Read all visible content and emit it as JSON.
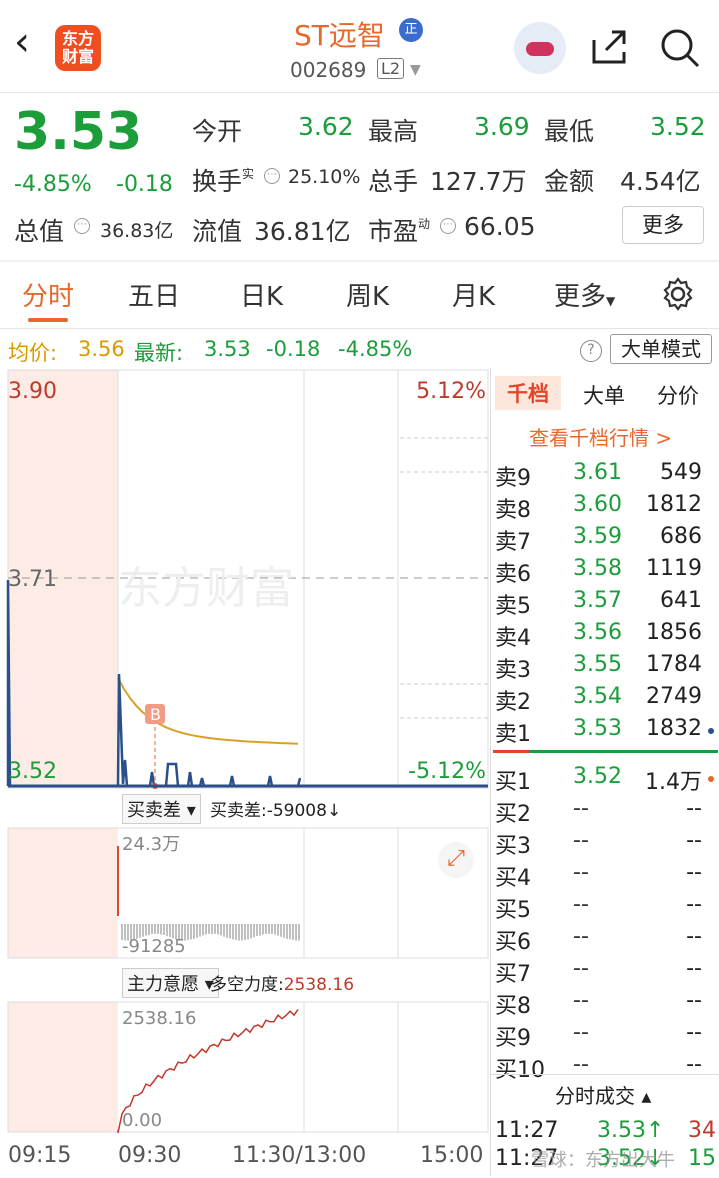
{
  "header": {
    "back_icon": "chevron-left-icon",
    "logo_line1": "东方",
    "logo_line2": "财富",
    "stock_name": "ST远智",
    "badge": "正",
    "code": "002689",
    "level": "L2"
  },
  "quote": {
    "price": "3.53",
    "pct": "-4.85%",
    "chg": "-0.18",
    "open_label": "今开",
    "open": "3.62",
    "high_label": "最高",
    "high": "3.69",
    "low_label": "最低",
    "low": "3.52",
    "turnover_label": "换手",
    "turnover_sup": "实",
    "turnover": "25.10%",
    "vol_label": "总手",
    "vol": "127.7万",
    "amount_label": "金额",
    "amount": "4.54亿",
    "mcap_label": "总值",
    "mcap": "36.83亿",
    "float_label": "流值",
    "float": "36.81亿",
    "pe_label": "市盈",
    "pe_sup": "动",
    "pe": "66.05",
    "more": "更多"
  },
  "tabs": [
    "分时",
    "五日",
    "日K",
    "周K",
    "月K",
    "更多"
  ],
  "avgbar": {
    "avg_label": "均价:",
    "avg": "3.56",
    "last_label": "最新:",
    "last": "3.53",
    "chg": "-0.18",
    "pct": "-4.85%",
    "mode_btn": "大单模式"
  },
  "chart": {
    "y_top": "3.90",
    "y_mid": "3.71",
    "y_bot": "3.52",
    "pct_top": "5.12%",
    "pct_bot": "-5.12%",
    "b_marker": "B",
    "ind1_label": "买卖差",
    "ind1_value": "买卖差:-59008↓",
    "ind1_top": "24.3万",
    "ind1_bot": "-91285",
    "ind2_label": "主力意愿",
    "ind2_value_label": "多空力度:",
    "ind2_value": "2538.16",
    "ind2_top": "2538.16",
    "ind2_bot": "0.00",
    "times": [
      "09:15",
      "09:30",
      "11:30/13:00",
      "15:00"
    ],
    "watermark": "东方财富"
  },
  "chart_data": {
    "type": "line",
    "title": "",
    "x": [
      "09:15",
      "09:30",
      "11:30/13:00",
      "15:00"
    ],
    "ylim": [
      3.52,
      3.9
    ],
    "series": [
      {
        "name": "均价",
        "values": [
          3.62,
          3.58,
          3.56
        ]
      }
    ]
  },
  "book": {
    "tabs": [
      "千档",
      "大单",
      "分价"
    ],
    "link": "查看千档行情 >",
    "asks": [
      [
        "卖9",
        "3.61",
        "549"
      ],
      [
        "卖8",
        "3.60",
        "1812"
      ],
      [
        "卖7",
        "3.59",
        "686"
      ],
      [
        "卖6",
        "3.58",
        "1119"
      ],
      [
        "卖5",
        "3.57",
        "641"
      ],
      [
        "卖4",
        "3.56",
        "1856"
      ],
      [
        "卖3",
        "3.55",
        "1784"
      ],
      [
        "卖2",
        "3.54",
        "2749"
      ],
      [
        "卖1",
        "3.53",
        "1832"
      ]
    ],
    "bids": [
      [
        "买1",
        "3.52",
        "1.4万"
      ],
      [
        "买2",
        "--",
        "--"
      ],
      [
        "买3",
        "--",
        "--"
      ],
      [
        "买4",
        "--",
        "--"
      ],
      [
        "买5",
        "--",
        "--"
      ],
      [
        "买6",
        "--",
        "--"
      ],
      [
        "买7",
        "--",
        "--"
      ],
      [
        "买8",
        "--",
        "--"
      ],
      [
        "买9",
        "--",
        "--"
      ],
      [
        "买10",
        "--",
        "--"
      ]
    ],
    "trades_title": "分时成交",
    "trades": [
      [
        "11:27",
        "3.53↑",
        "34"
      ],
      [
        "11:27",
        "3.52↓",
        "15"
      ]
    ],
    "footer": "雪球：东方出大牛"
  }
}
